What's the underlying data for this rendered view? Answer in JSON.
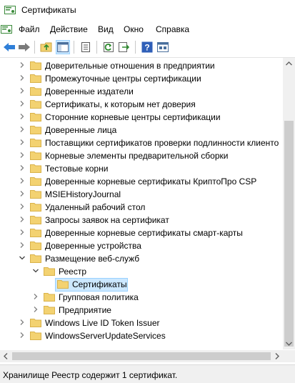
{
  "window": {
    "title": "Сертификаты"
  },
  "menu": [
    "Файл",
    "Действие",
    "Вид",
    "Окно",
    "Справка"
  ],
  "toolbar": {
    "buttons": [
      "back-arrow-icon",
      "forward-arrow-icon",
      "up-folder-icon",
      "show-tree-icon",
      "properties-icon",
      "refresh-icon",
      "export-icon",
      "help-icon",
      "view-icon"
    ]
  },
  "tree": {
    "items": [
      {
        "label": "Доверительные отношения в предприятии",
        "level": 1,
        "chevron": "collapsed"
      },
      {
        "label": "Промежуточные центры сертификации",
        "level": 1,
        "chevron": "collapsed"
      },
      {
        "label": "Доверенные издатели",
        "level": 1,
        "chevron": "collapsed"
      },
      {
        "label": "Сертификаты, к которым нет доверия",
        "level": 1,
        "chevron": "collapsed"
      },
      {
        "label": "Сторонние корневые центры сертификации",
        "level": 1,
        "chevron": "collapsed"
      },
      {
        "label": "Доверенные лица",
        "level": 1,
        "chevron": "collapsed"
      },
      {
        "label": "Поставщики сертификатов проверки подлинности клиенто",
        "level": 1,
        "chevron": "collapsed"
      },
      {
        "label": "Корневые элементы предварительной сборки",
        "level": 1,
        "chevron": "collapsed"
      },
      {
        "label": "Тестовые корни",
        "level": 1,
        "chevron": "collapsed"
      },
      {
        "label": "Доверенные корневые сертификаты КриптоПро CSP",
        "level": 1,
        "chevron": "collapsed"
      },
      {
        "label": "MSIEHistoryJournal",
        "level": 1,
        "chevron": "collapsed"
      },
      {
        "label": "Удаленный рабочий стол",
        "level": 1,
        "chevron": "collapsed"
      },
      {
        "label": "Запросы заявок на сертификат",
        "level": 1,
        "chevron": "collapsed"
      },
      {
        "label": "Доверенные корневые сертификаты смарт-карты",
        "level": 1,
        "chevron": "collapsed"
      },
      {
        "label": "Доверенные устройства",
        "level": 1,
        "chevron": "collapsed"
      },
      {
        "label": "Размещение веб-служб",
        "level": 1,
        "chevron": "expanded"
      },
      {
        "label": "Реестр",
        "level": 2,
        "chevron": "expanded"
      },
      {
        "label": "Сертификаты",
        "level": 3,
        "chevron": "none",
        "selected": true
      },
      {
        "label": "Групповая политика",
        "level": 2,
        "chevron": "collapsed"
      },
      {
        "label": "Предприятие",
        "level": 2,
        "chevron": "collapsed"
      },
      {
        "label": "Windows Live ID Token Issuer",
        "level": 1,
        "chevron": "collapsed"
      },
      {
        "label": "WindowsServerUpdateServices",
        "level": 1,
        "chevron": "collapsed"
      }
    ]
  },
  "status": {
    "text": "Хранилище Реестр содержит 1 сертификат."
  },
  "colors": {
    "folder": "#f3d271",
    "folder_dark": "#d9b24a",
    "selection": "#cce8ff",
    "selection_border": "#99d1ff"
  }
}
